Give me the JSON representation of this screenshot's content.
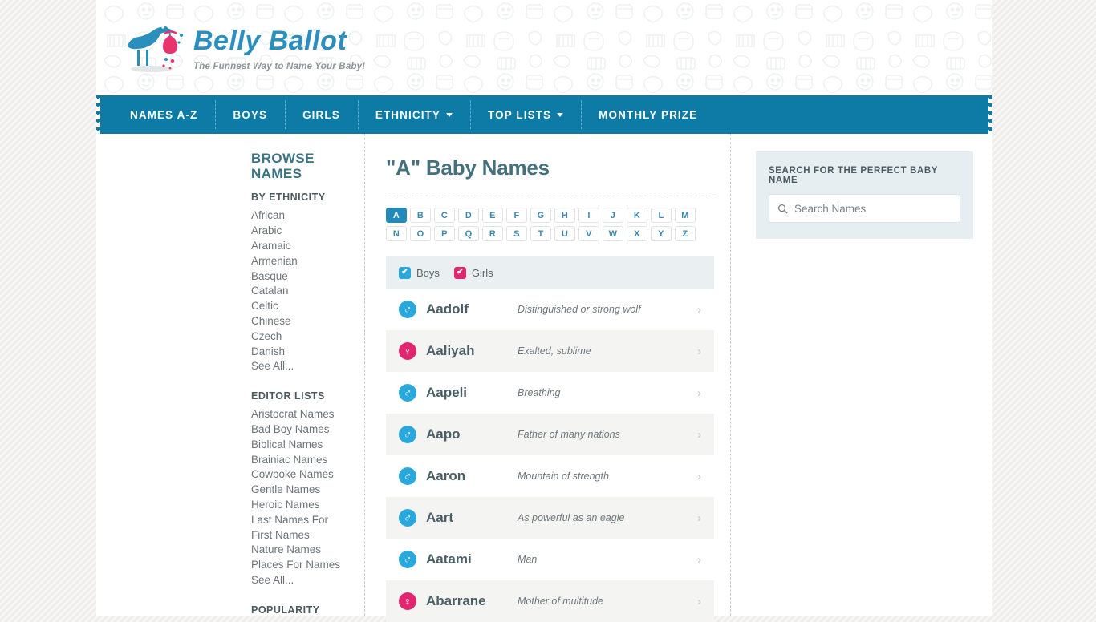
{
  "brand": {
    "name": "Belly Ballot",
    "tagline": "The Funnest Way to Name Your Baby!",
    "logo_icon": "stork-with-bundle-icon",
    "primary_blue": "#2a8fbd",
    "accent_pink": "#e0266f",
    "nav_blue": "#0d7ba5"
  },
  "nav": {
    "items": [
      {
        "label": "NAMES A-Z",
        "has_caret": false
      },
      {
        "label": "BOYS",
        "has_caret": false
      },
      {
        "label": "GIRLS",
        "has_caret": false
      },
      {
        "label": "ETHNICITY",
        "has_caret": true
      },
      {
        "label": "TOP LISTS",
        "has_caret": true
      },
      {
        "label": "MONTHLY PRIZE",
        "has_caret": false
      }
    ]
  },
  "sidebar": {
    "heading": "BROWSE NAMES",
    "sections": [
      {
        "heading": "BY ETHNICITY",
        "links": [
          "African",
          "Arabic",
          "Aramaic",
          "Armenian",
          "Basque",
          "Catalan",
          "Celtic",
          "Chinese",
          "Czech",
          "Danish",
          "See All..."
        ]
      },
      {
        "heading": "EDITOR LISTS",
        "links": [
          "Aristocrat Names",
          "Bad Boy Names",
          "Biblical Names",
          "Brainiac Names",
          "Cowpoke Names",
          "Gentle Names",
          "Heroic Names",
          "Last Names For First Names",
          "Nature Names",
          "Places For Names",
          "See All..."
        ]
      },
      {
        "heading": "POPULARITY",
        "links": []
      }
    ]
  },
  "main": {
    "title": "\"A\" Baby Names",
    "alphabet": {
      "letters": [
        "A",
        "B",
        "C",
        "D",
        "E",
        "F",
        "G",
        "H",
        "I",
        "J",
        "K",
        "L",
        "M",
        "N",
        "O",
        "P",
        "Q",
        "R",
        "S",
        "T",
        "U",
        "V",
        "W",
        "X",
        "Y",
        "Z"
      ],
      "active": "A"
    },
    "filters": [
      {
        "id": "boys",
        "label": "Boys",
        "checked": true,
        "color": "#29a8dd",
        "check_glyph": "✔"
      },
      {
        "id": "girls",
        "label": "Girls",
        "checked": true,
        "color": "#e0266f",
        "check_glyph": "✔"
      }
    ],
    "chevron_glyph": "›",
    "male_glyph": "♂",
    "female_glyph": "♀",
    "names": [
      {
        "name": "Aadolf",
        "meaning": "Distinguished or strong wolf",
        "gender": "boy"
      },
      {
        "name": "Aaliyah",
        "meaning": "Exalted, sublime",
        "gender": "girl"
      },
      {
        "name": "Aapeli",
        "meaning": "Breathing",
        "gender": "boy"
      },
      {
        "name": "Aapo",
        "meaning": "Father of many nations",
        "gender": "boy"
      },
      {
        "name": "Aaron",
        "meaning": "Mountain of strength",
        "gender": "boy"
      },
      {
        "name": "Aart",
        "meaning": "As powerful as an eagle",
        "gender": "boy"
      },
      {
        "name": "Aatami",
        "meaning": "Man",
        "gender": "boy"
      },
      {
        "name": "Abarrane",
        "meaning": "Mother of multitude",
        "gender": "girl"
      }
    ]
  },
  "search": {
    "panel_title": "SEARCH FOR THE PERFECT BABY NAME",
    "placeholder": "Search Names",
    "value": "",
    "icon": "search-icon"
  }
}
